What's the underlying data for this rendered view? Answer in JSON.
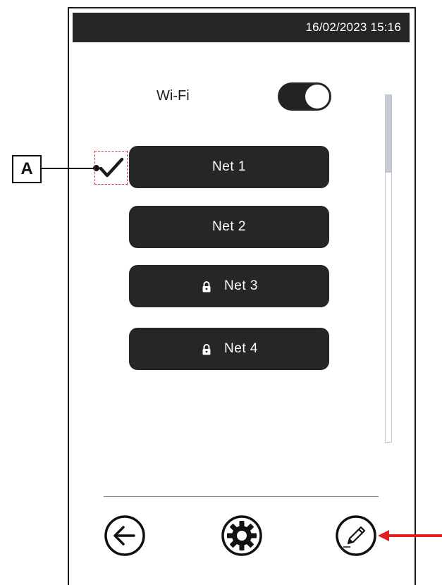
{
  "status_bar": {
    "datetime": "16/02/2023 15:16"
  },
  "wifi": {
    "label": "Wi-Fi",
    "enabled": true
  },
  "networks": [
    {
      "label": "Net 1",
      "locked": false,
      "connected": true
    },
    {
      "label": "Net 2",
      "locked": false,
      "connected": false
    },
    {
      "label": "Net 3",
      "locked": true,
      "connected": false
    },
    {
      "label": "Net 4",
      "locked": true,
      "connected": false
    }
  ],
  "callout": {
    "label": "A"
  },
  "icons": {
    "back": "back-arrow-icon",
    "settings": "gear-icon",
    "edit": "pencil-icon",
    "lock": "lock-icon",
    "check": "checkmark-icon"
  },
  "colors": {
    "button_bg": "#262626",
    "status_bar_bg": "#262626",
    "annotation_red": "#e02020",
    "scroll_thumb": "#c5ccd3"
  }
}
